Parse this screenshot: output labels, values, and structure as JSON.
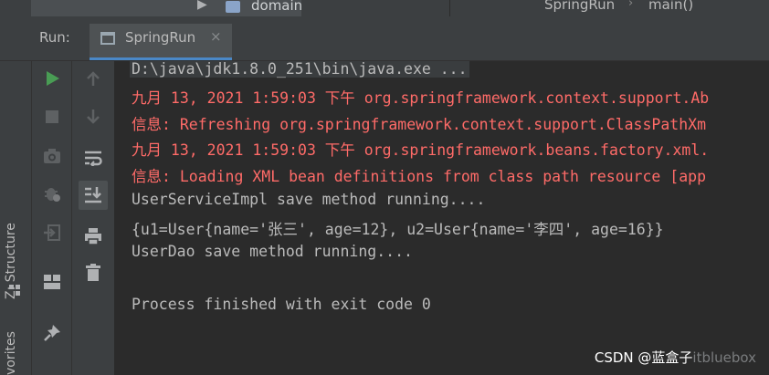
{
  "colors": {
    "panel": "#3c3f41",
    "console_bg": "#2b2b2b",
    "error_text": "#ff6b68",
    "normal_text": "#bbbbbb",
    "run_green": "#499c54",
    "tab_underline": "#4a88c7"
  },
  "navbar": {
    "project_item": "domain",
    "breadcrumb": [
      "SpringRun",
      "main()"
    ]
  },
  "run_panel": {
    "title": "Run:",
    "tab_label": "SpringRun",
    "tab_close": "×"
  },
  "left_stripe": {
    "structure_label": "Z: Structure",
    "favorites_label": "vorites"
  },
  "toolbar_icons": {
    "left_column": [
      "run-icon",
      "stop-icon",
      "camera-icon",
      "bug-icon",
      "exit-icon",
      "layout-icon",
      "pin-icon"
    ],
    "right_column": [
      "arrow-up-icon",
      "arrow-down-icon",
      "soft-wrap-icon",
      "scroll-to-end-icon",
      "print-icon",
      "trash-icon"
    ]
  },
  "console": {
    "lines": [
      {
        "kind": "cmd",
        "text": "D:\\java\\jdk1.8.0_251\\bin\\java.exe ..."
      },
      {
        "kind": "err",
        "text": "九月 13, 2021 1:59:03 下午 org.springframework.context.support.Ab"
      },
      {
        "kind": "err",
        "text": "信息: Refreshing org.springframework.context.support.ClassPathXm"
      },
      {
        "kind": "err",
        "text": "九月 13, 2021 1:59:03 下午 org.springframework.beans.factory.xml."
      },
      {
        "kind": "err",
        "text": "信息: Loading XML bean definitions from class path resource [app"
      },
      {
        "kind": "out",
        "text": "UserServiceImpl save method running...."
      },
      {
        "kind": "out",
        "text": "{u1=User{name='张三', age=12}, u2=User{name='李四', age=16}}"
      },
      {
        "kind": "out",
        "text": "UserDao save method running...."
      },
      {
        "kind": "out",
        "text": ""
      },
      {
        "kind": "out",
        "text": "Process finished with exit code 0"
      }
    ]
  },
  "watermark": {
    "main": "CSDN @蓝盒子",
    "faded": "itbluebox"
  }
}
